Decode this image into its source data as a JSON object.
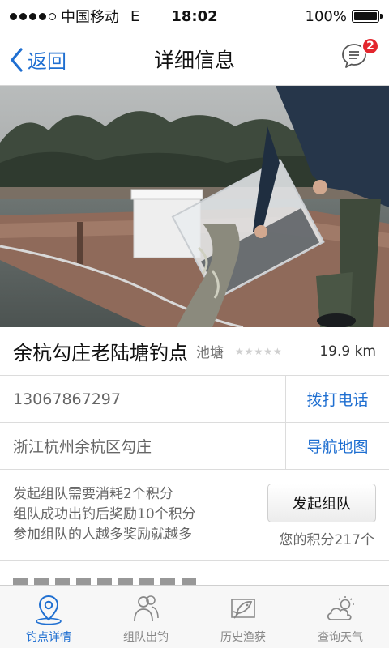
{
  "status_bar": {
    "carrier": "中国移动",
    "network": "E",
    "time": "18:02",
    "battery": "100%",
    "battery_level": 1.0
  },
  "nav": {
    "back_label": "返回",
    "title": "详细信息",
    "message_badge": "2"
  },
  "spot": {
    "name": "余杭勾庄老陆塘钓点",
    "type": "池塘",
    "stars": "★★★★★",
    "distance": "19.9 km"
  },
  "contact": {
    "phone": "13067867297",
    "call_label": "拨打电话",
    "address": "浙江杭州余杭区勾庄",
    "navigate_label": "导航地图"
  },
  "team": {
    "lines": [
      "发起组队需要消耗2个积分",
      "组队成功出钓后奖励10个积分",
      "参加组队的人越多奖励就越多"
    ],
    "button_label": "发起组队",
    "points_text": "您的积分217个"
  },
  "tabs": [
    {
      "label": "钓点详情",
      "icon": "location-pin-icon",
      "active": true
    },
    {
      "label": "组队出钓",
      "icon": "people-icon",
      "active": false
    },
    {
      "label": "历史渔获",
      "icon": "fish-icon",
      "active": false
    },
    {
      "label": "查询天气",
      "icon": "weather-icon",
      "active": false
    }
  ],
  "colors": {
    "accent": "#1f6fd1",
    "badge": "#e3262d"
  }
}
